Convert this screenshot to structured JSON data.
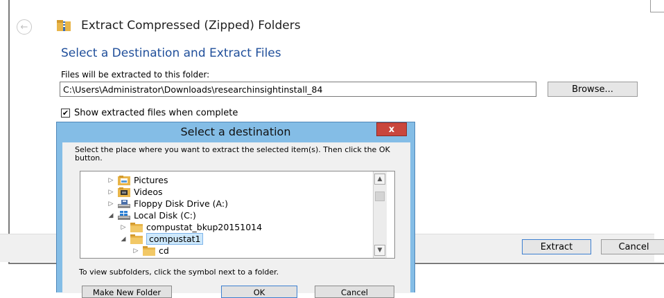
{
  "wizard": {
    "title": "Extract Compressed (Zipped) Folders",
    "heading": "Select a Destination and Extract Files",
    "path_label": "Files will be extracted to this folder:",
    "path_value": "C:\\Users\\Administrator\\Downloads\\researchinsightinstall_84",
    "browse_label": "Browse...",
    "show_files_label": "Show extracted files when complete",
    "show_files_checked": true,
    "extract_label": "Extract",
    "cancel_label": "Cancel"
  },
  "dialog": {
    "title": "Select a destination",
    "close_glyph": "x",
    "instruction": "Select the place where you want to extract the selected item(s).  Then click the OK button.",
    "tree": [
      {
        "label": "Pictures",
        "icon": "pictures-folder-icon",
        "expander": "collapsed",
        "level": 1
      },
      {
        "label": "Videos",
        "icon": "videos-folder-icon",
        "expander": "collapsed",
        "level": 1
      },
      {
        "label": "Floppy Disk Drive (A:)",
        "icon": "floppy-drive-icon",
        "expander": "collapsed",
        "level": 1
      },
      {
        "label": "Local Disk (C:)",
        "icon": "local-disk-icon",
        "expander": "expanded",
        "level": 1
      },
      {
        "label": "compustat_bkup20151014",
        "icon": "folder-icon",
        "expander": "collapsed",
        "level": 2
      },
      {
        "label": "compustat1",
        "icon": "folder-icon",
        "expander": "expanded",
        "level": 2,
        "selected": true
      },
      {
        "label": "cd",
        "icon": "folder-icon",
        "expander": "collapsed",
        "level": 3
      }
    ],
    "hint": "To view subfolders, click the symbol next to a folder.",
    "make_new_folder_label": "Make New Folder",
    "ok_label": "OK",
    "cancel_label": "Cancel"
  },
  "colors": {
    "heading_blue": "#1f4e9a",
    "dialog_frame": "#84bde6",
    "close_red": "#c9463d",
    "selection": "#cde8fb"
  }
}
